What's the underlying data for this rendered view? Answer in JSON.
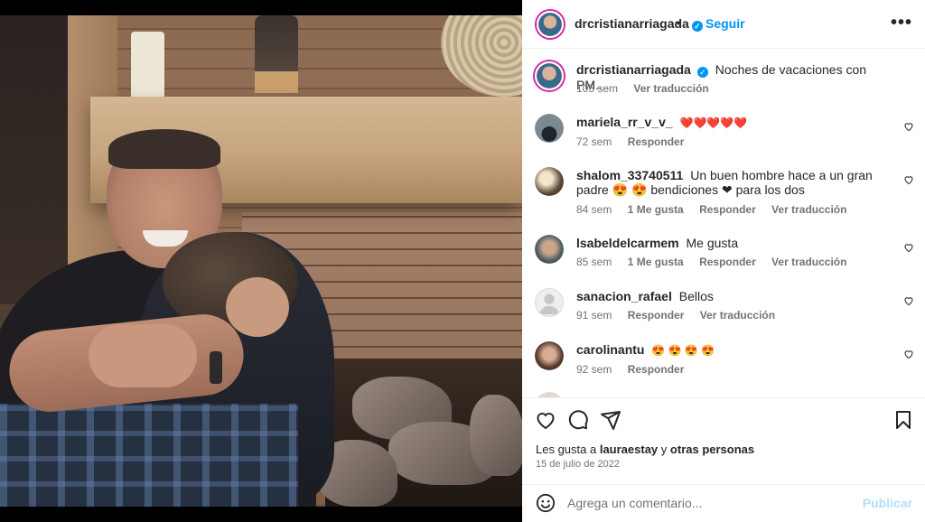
{
  "post": {
    "author": "drcristianarriagada",
    "verified": true,
    "follow_label": "Seguir",
    "separator": "•",
    "more_icon": "more-horizontal-icon",
    "caption": "Noches de vacaciones con PM....",
    "caption_age": "105 sem",
    "caption_translate": "Ver traducción"
  },
  "comments": [
    {
      "user": "mariela_rr_v_v_",
      "text": "❤️❤️❤️❤️❤️",
      "age": "72 sem",
      "likes": "",
      "reply": "Responder",
      "translate": "",
      "avatar_color": "#3d4a52"
    },
    {
      "user": "shalom_33740511",
      "text": "Un buen hombre hace a un gran padre 😍 😍 bendiciones ❤ para los dos",
      "age": "84 sem",
      "likes": "1 Me gusta",
      "reply": "Responder",
      "translate": "Ver traducción",
      "avatar_color": "#8a7a66"
    },
    {
      "user": "lsabeldelcarmem",
      "text": "Me gusta",
      "age": "85 sem",
      "likes": "1 Me gusta",
      "reply": "Responder",
      "translate": "Ver traducción",
      "avatar_color": "#6e7d8a"
    },
    {
      "user": "sanacion_rafael",
      "text": "Bellos",
      "age": "91 sem",
      "likes": "",
      "reply": "Responder",
      "translate": "Ver traducción",
      "avatar_color": "#dbdbdb"
    },
    {
      "user": "carolinantu",
      "text": "😍 😍 😍 😍",
      "age": "92 sem",
      "likes": "",
      "reply": "Responder",
      "translate": "",
      "avatar_color": "#7a5a4e"
    }
  ],
  "footer": {
    "likes_prefix": "Les gusta a",
    "likes_user": "lauraestay",
    "likes_and": "y",
    "likes_others": "otras personas",
    "date": "15 de julio de 2022",
    "comment_placeholder": "Agrega un comentario...",
    "post_label": "Publicar"
  },
  "colors": {
    "accent": "#0095f6",
    "post_disabled": "#b2dffc",
    "heart": "#ed4956"
  }
}
